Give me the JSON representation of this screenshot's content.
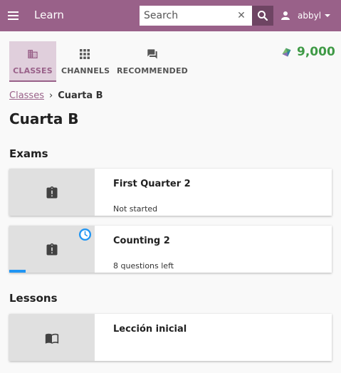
{
  "appbar": {
    "title": "Learn",
    "search_placeholder": "Search",
    "user_name": "abbyl"
  },
  "tabs": [
    {
      "label": "CLASSES",
      "icon": "classes-icon",
      "active": true
    },
    {
      "label": "CHANNELS",
      "icon": "channels-grid-icon",
      "active": false
    },
    {
      "label": "RECOMMENDED",
      "icon": "recommended-chat-icon",
      "active": false
    }
  ],
  "points": {
    "value": "9,000",
    "color": "#3f9a46"
  },
  "breadcrumb": {
    "parent": "Classes",
    "separator": "›",
    "current": "Cuarta B"
  },
  "page_title": "Cuarta B",
  "exams": {
    "heading": "Exams",
    "items": [
      {
        "title": "First Quarter 2",
        "status": "Not started",
        "icon": "assignment-late-icon"
      },
      {
        "title": "Counting 2",
        "status": "8 questions left",
        "icon": "assignment-late-icon",
        "badge": "clock-icon",
        "progress": 0.05
      }
    ]
  },
  "lessons": {
    "heading": "Lessons",
    "items": [
      {
        "title": "Lección inicial",
        "icon": "book-icon"
      }
    ]
  },
  "colors": {
    "brand": "#996189",
    "brand_dark": "#6e4463",
    "tab_active_bg": "#e0cfdc",
    "progress": "#2196f3"
  }
}
